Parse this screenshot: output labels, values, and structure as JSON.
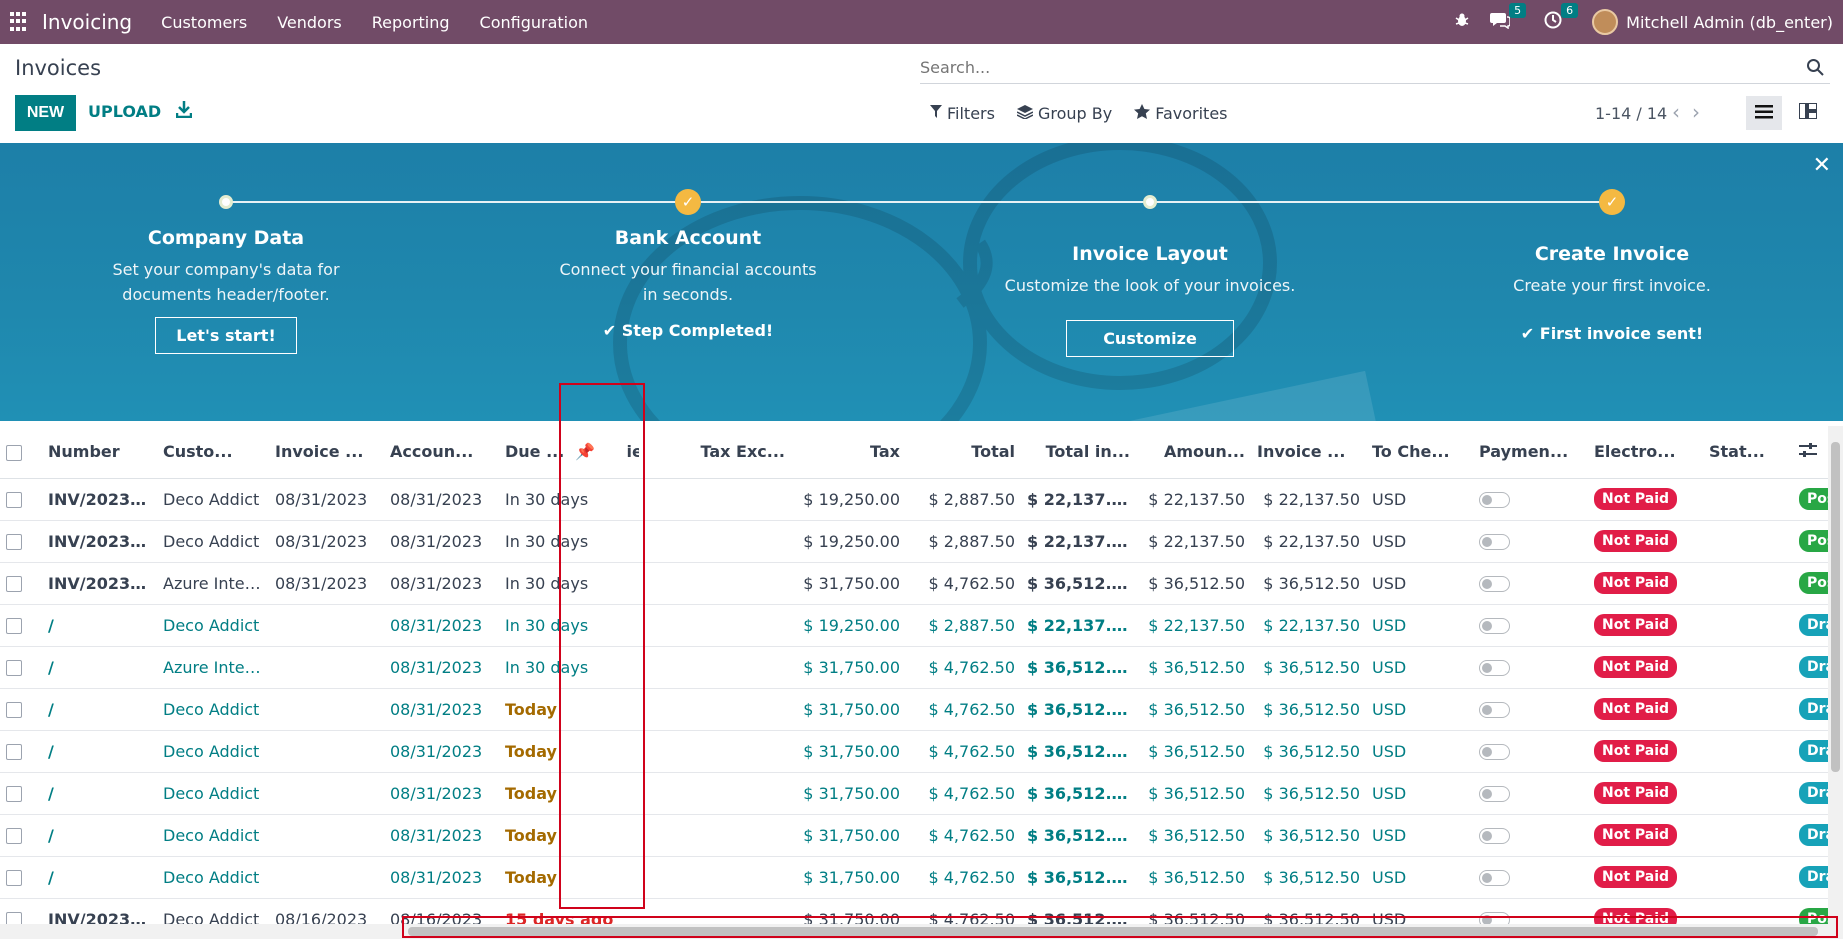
{
  "navbar": {
    "app_name": "Invoicing",
    "menu": [
      "Customers",
      "Vendors",
      "Reporting",
      "Configuration"
    ],
    "messages_count": "5",
    "activities_count": "6",
    "user": "Mitchell Admin (db_enter)"
  },
  "control": {
    "title": "Invoices",
    "new_label": "NEW",
    "upload_label": "UPLOAD",
    "search_placeholder": "Search...",
    "filters_label": "Filters",
    "groupby_label": "Group By",
    "favorites_label": "Favorites",
    "pager": "1-14 / 14"
  },
  "banner": {
    "steps": [
      {
        "title": "Company Data",
        "desc": "Set your company's data for documents header/footer.",
        "action": "Let's start!"
      },
      {
        "title": "Bank Account",
        "desc": "Connect your financial accounts in seconds.",
        "done": "Step Completed!"
      },
      {
        "title": "Invoice Layout",
        "desc": "Customize the look of your invoices.",
        "action": "Customize"
      },
      {
        "title": "Create Invoice",
        "desc": "Create your first invoice.",
        "done": "First invoice sent!"
      }
    ]
  },
  "table": {
    "headers": [
      "Number",
      "Custo...",
      "Invoice ...",
      "Accoun...",
      "Due ...",
      "ies",
      "Tax Exc...",
      "Tax",
      "Total",
      "Total in...",
      "Amoun...",
      "Invoice ...",
      "To Che...",
      "Paymen...",
      "Electro...",
      "Stat..."
    ],
    "rows": [
      {
        "number": "INV/2023/0...",
        "customer": "Deco Addict",
        "invoice_date": "08/31/2023",
        "accounting_date": "08/31/2023",
        "due": "In 30 days",
        "tax_excl": "$ 19,250.00",
        "tax": "$ 2,887.50",
        "total": "$ 22,137.50",
        "total_currency": "$ 22,137.50",
        "amount_due": "$ 22,137.50",
        "currency": "USD",
        "payment": "Not Paid",
        "status": "Posted"
      },
      {
        "number": "INV/2023/0...",
        "customer": "Deco Addict",
        "invoice_date": "08/31/2023",
        "accounting_date": "08/31/2023",
        "due": "In 30 days",
        "tax_excl": "$ 19,250.00",
        "tax": "$ 2,887.50",
        "total": "$ 22,137.50",
        "total_currency": "$ 22,137.50",
        "amount_due": "$ 22,137.50",
        "currency": "USD",
        "payment": "Not Paid",
        "status": "Posted"
      },
      {
        "number": "INV/2023/0...",
        "customer": "Azure Inter...",
        "invoice_date": "08/31/2023",
        "accounting_date": "08/31/2023",
        "due": "In 30 days",
        "tax_excl": "$ 31,750.00",
        "tax": "$ 4,762.50",
        "total": "$ 36,512.50",
        "total_currency": "$ 36,512.50",
        "amount_due": "$ 36,512.50",
        "currency": "USD",
        "payment": "Not Paid",
        "status": "Posted"
      },
      {
        "number": "/",
        "customer": "Deco Addict",
        "invoice_date": "",
        "accounting_date": "08/31/2023",
        "due": "In 30 days",
        "tax_excl": "$ 19,250.00",
        "tax": "$ 2,887.50",
        "total": "$ 22,137.50",
        "total_currency": "$ 22,137.50",
        "amount_due": "$ 22,137.50",
        "currency": "USD",
        "payment": "Not Paid",
        "status": "Draft"
      },
      {
        "number": "/",
        "customer": "Azure Inter...",
        "invoice_date": "",
        "accounting_date": "08/31/2023",
        "due": "In 30 days",
        "tax_excl": "$ 31,750.00",
        "tax": "$ 4,762.50",
        "total": "$ 36,512.50",
        "total_currency": "$ 36,512.50",
        "amount_due": "$ 36,512.50",
        "currency": "USD",
        "payment": "Not Paid",
        "status": "Draft"
      },
      {
        "number": "/",
        "customer": "Deco Addict",
        "invoice_date": "",
        "accounting_date": "08/31/2023",
        "due": "Today",
        "tax_excl": "$ 31,750.00",
        "tax": "$ 4,762.50",
        "total": "$ 36,512.50",
        "total_currency": "$ 36,512.50",
        "amount_due": "$ 36,512.50",
        "currency": "USD",
        "payment": "Not Paid",
        "status": "Draft"
      },
      {
        "number": "/",
        "customer": "Deco Addict",
        "invoice_date": "",
        "accounting_date": "08/31/2023",
        "due": "Today",
        "tax_excl": "$ 31,750.00",
        "tax": "$ 4,762.50",
        "total": "$ 36,512.50",
        "total_currency": "$ 36,512.50",
        "amount_due": "$ 36,512.50",
        "currency": "USD",
        "payment": "Not Paid",
        "status": "Draft"
      },
      {
        "number": "/",
        "customer": "Deco Addict",
        "invoice_date": "",
        "accounting_date": "08/31/2023",
        "due": "Today",
        "tax_excl": "$ 31,750.00",
        "tax": "$ 4,762.50",
        "total": "$ 36,512.50",
        "total_currency": "$ 36,512.50",
        "amount_due": "$ 36,512.50",
        "currency": "USD",
        "payment": "Not Paid",
        "status": "Draft"
      },
      {
        "number": "/",
        "customer": "Deco Addict",
        "invoice_date": "",
        "accounting_date": "08/31/2023",
        "due": "Today",
        "tax_excl": "$ 31,750.00",
        "tax": "$ 4,762.50",
        "total": "$ 36,512.50",
        "total_currency": "$ 36,512.50",
        "amount_due": "$ 36,512.50",
        "currency": "USD",
        "payment": "Not Paid",
        "status": "Draft"
      },
      {
        "number": "/",
        "customer": "Deco Addict",
        "invoice_date": "",
        "accounting_date": "08/31/2023",
        "due": "Today",
        "tax_excl": "$ 31,750.00",
        "tax": "$ 4,762.50",
        "total": "$ 36,512.50",
        "total_currency": "$ 36,512.50",
        "amount_due": "$ 36,512.50",
        "currency": "USD",
        "payment": "Not Paid",
        "status": "Draft"
      },
      {
        "number": "INV/2023/0...",
        "customer": "Deco Addict",
        "invoice_date": "08/16/2023",
        "accounting_date": "08/16/2023",
        "due": "15 days ago",
        "tax_excl": "$ 31,750.00",
        "tax": "$ 4,762.50",
        "total": "$ 36,512.50",
        "total_currency": "$ 36,512.50",
        "amount_due": "$ 36,512.50",
        "currency": "USD",
        "payment": "Not Paid",
        "status": "Posted"
      }
    ]
  },
  "colors": {
    "navbar": "#714b67",
    "primary": "#017e84",
    "not_paid": "#e11d48",
    "posted": "#28a745",
    "draft": "#17a2b8",
    "annotation": "#d0021b"
  }
}
